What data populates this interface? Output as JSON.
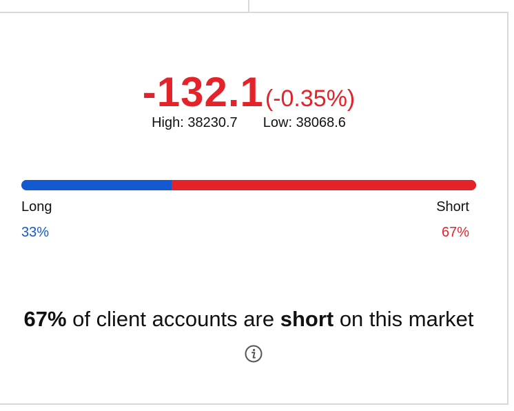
{
  "quote": {
    "change_value": "-132.1",
    "change_percent": "(-0.35%)",
    "high_label": "High:",
    "high_value": "38230.7",
    "low_label": "Low:",
    "low_value": "38068.6"
  },
  "sentiment": {
    "long_label": "Long",
    "short_label": "Short",
    "long_percent": "33%",
    "short_percent": "67%",
    "long_fraction": 0.33,
    "short_fraction": 0.67
  },
  "summary": {
    "percent": "67%",
    "text_before": " of client accounts are ",
    "position": "short",
    "text_after": " on this market"
  },
  "icons": {
    "info": "info-icon"
  },
  "colors": {
    "negative": "#e4222a",
    "long": "#1359d0",
    "short": "#e4222a",
    "border": "#d9d9d9"
  }
}
